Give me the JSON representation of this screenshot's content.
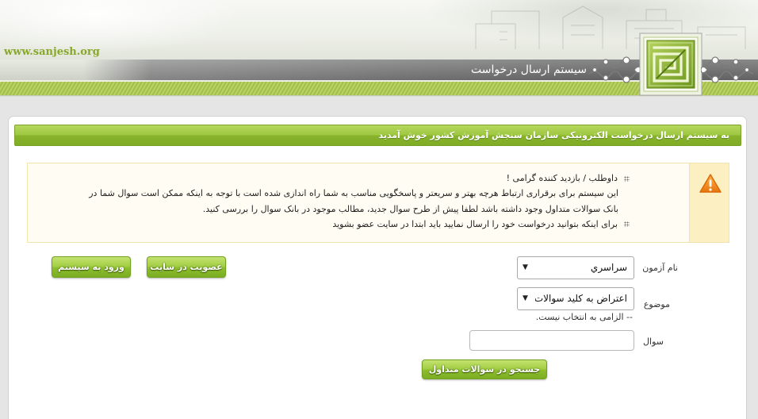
{
  "header": {
    "site_url": "www.sanjesh.org",
    "system_title": "سیستم ارسال درخواست"
  },
  "welcome": {
    "text": "به سیستم ارسال درخواست الکترونیکی سازمان سنجش آموزش کشور خوش آمدید"
  },
  "notice": {
    "items": [
      {
        "title": "داوطلب / بازدید کننده گرامی !",
        "lines": [
          "این سیستم برای برقراری ارتباط هرچه بهتر و سریعتر و پاسخگویی مناسب به شما راه اندازی شده است با توجه به اینکه ممکن است سوال شما در",
          "بانک سوالات متداول وجود داشته باشد لطفا پیش از طرح سوال جدید، مطالب موجود در بانک سوال را بررسی کنید."
        ]
      },
      {
        "title": "برای اینکه بتوانید درخواست خود را ارسال نمایید باید ابتدا در سایت عضو بشوید"
      }
    ]
  },
  "form": {
    "exam": {
      "label": "نام آزمون",
      "selected": "سراسري"
    },
    "subject": {
      "label": "موضوع",
      "selected": "اعتراض به كليد سوالات",
      "hint": "-- الزامی به انتخاب نیست."
    },
    "question": {
      "label": "سوال"
    },
    "search_button": "جستجو در سوالات متداول"
  },
  "account": {
    "register_button": "عضویت در سایت",
    "login_button": "ورود به سیستم"
  },
  "icons": {
    "logo": "sanjesh-emblem",
    "notice": "warning",
    "list_bullet": "dotted-bullet",
    "dropdown": "dropdown-arrow"
  },
  "colors": {
    "brand_green": "#8cb834",
    "site_url_green": "#88a82c",
    "header_bar_gray": "#777777",
    "notice_background": "#fffdf3",
    "notice_icon_background": "#fcefc2",
    "warning_orange": "#f08a1c",
    "page_background": "#e5e5e5"
  }
}
